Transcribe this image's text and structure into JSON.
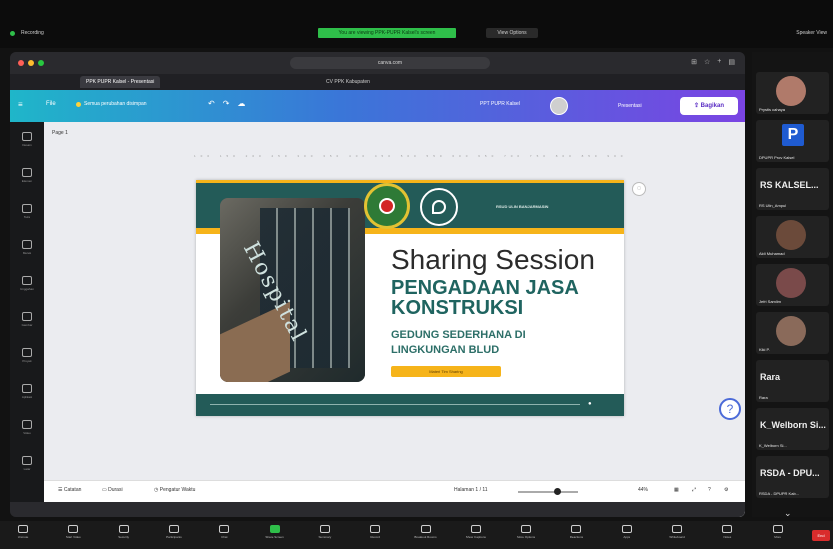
{
  "zoom_top": {
    "meeting_meta": "Recording",
    "share_banner": "You are viewing PPK-PUPR Kalsel's screen",
    "view_options": "View Options",
    "right_meta": "Speaker View"
  },
  "browser": {
    "url": "canva.com",
    "tabs": [
      "PPK PUPR Kalsel - Presentasi",
      "CV PPK Kabupaten"
    ],
    "active_tab": 0
  },
  "canva": {
    "file_label": "File",
    "saved_label": "Semua perubahan disimpan",
    "doc_name": "PPT PUPR Kalsel",
    "present_label": "Presentasi",
    "share_label": "Bagikan",
    "page_label": "Page 1",
    "ruler_text": "100 150 200 250 300 350 400 450 500 550 600 650 700 750 800 850 900 950",
    "sidebar_items": [
      "Desain",
      "Elemen",
      "Teks",
      "Merek",
      "Unggahan",
      "Gambar",
      "Proyek",
      "Aplikasi",
      "Video",
      "Latar"
    ],
    "footer": {
      "notes": "Catatan",
      "timer": "Durasi",
      "timer_icon_label": "Pengatur Waktu",
      "page_indicator": "Halaman 1 / 11",
      "zoom": "44%"
    },
    "colors": {
      "header_start": "#1fb6c9",
      "header_end": "#7a44e3",
      "accent": "#8b3dff"
    }
  },
  "slide": {
    "hospital_label": "RSUD ULIN BANJARMASIN",
    "title": "Sharing Session",
    "subtitle": "PENGADAAN JASA KONSTRUKSI",
    "subtitle2": "GEDUNG SEDERHANA DI LINGKUNGAN BLUD",
    "button_label": "Materi Tim Sharing",
    "photo_sign": "Hospital",
    "colors": {
      "teal": "#235b58",
      "yellow": "#f6b41a"
    }
  },
  "thumbnails": [
    {
      "color": "#235b58",
      "selected": true
    },
    {
      "color": "#235b58",
      "selected": false
    },
    {
      "color": "#2c5a7a",
      "selected": false
    },
    {
      "color": "#235b58",
      "selected": false
    },
    {
      "color": "#235b58",
      "selected": false
    },
    {
      "color": "#b07a1a",
      "selected": false
    },
    {
      "color": "#235b58",
      "selected": false
    },
    {
      "color": "#e0a21e",
      "selected": false
    },
    {
      "color": "#235b58",
      "selected": false
    },
    {
      "color": "#235b58",
      "selected": false
    },
    {
      "color": "#235b58",
      "selected": false
    }
  ],
  "participants": [
    {
      "name": "Prystis cahaya"
    },
    {
      "name": "DPUPR Prov Kalsel",
      "letter": "P"
    },
    {
      "name": "RS Ulin_Ampul",
      "big": "RS KALSEL..."
    },
    {
      "name": "Aldi Muhamad"
    },
    {
      "name": "Jefri Samlim"
    },
    {
      "name": "Kiki P."
    },
    {
      "name": "Rara",
      "big": "Rara"
    },
    {
      "name": "K_Welborn Si...",
      "big": "K_Welborn Si..."
    },
    {
      "name": "RSDA - DPUPR Kab...",
      "big": "RSDA - DPU..."
    }
  ],
  "zoom_bottom": [
    "Unmute",
    "Start Video",
    "Security",
    "Participants",
    "Chat",
    "Share Screen",
    "Summary",
    "Record",
    "Breakout Rooms",
    "Show Captions",
    "More Options",
    "Reactions",
    "Apps",
    "Whiteboard",
    "Notes",
    "More"
  ],
  "end_label": "End"
}
